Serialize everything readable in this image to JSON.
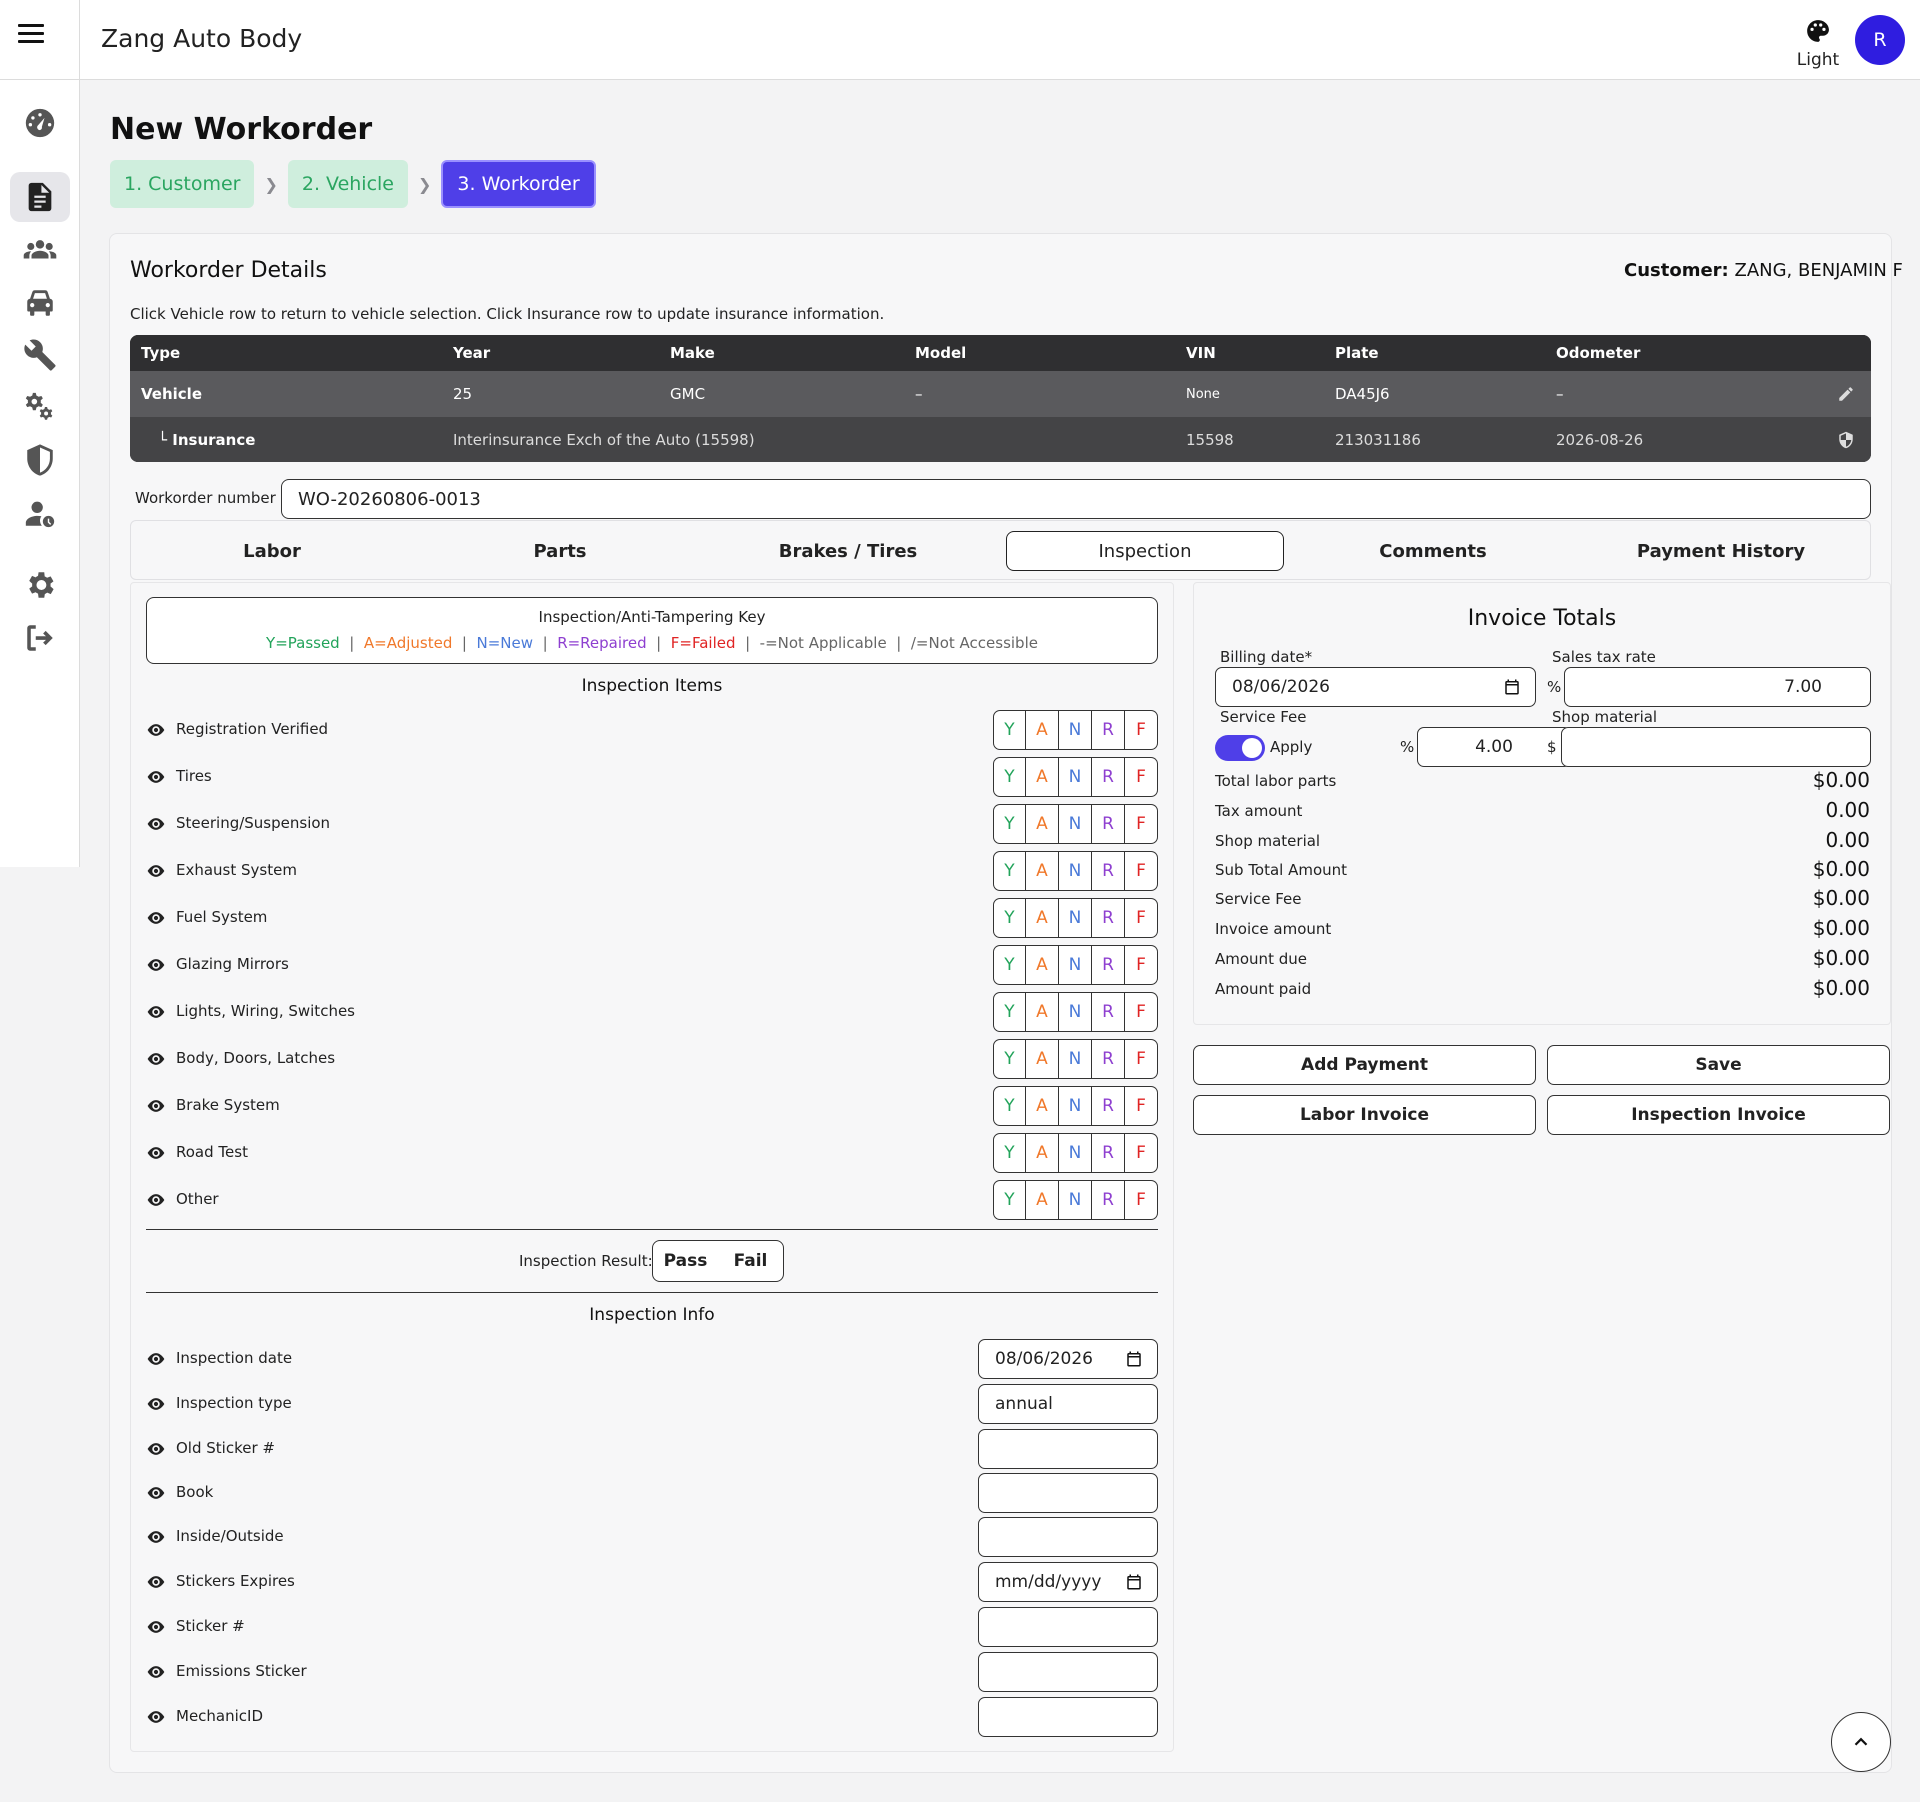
{
  "header": {
    "app_title": "Zang Auto Body",
    "theme_label": "Light",
    "avatar_initial": "R"
  },
  "sidebar": {
    "items": [
      "dashboard-icon",
      "workorders-icon",
      "customers-icon",
      "vehicles-icon",
      "services-icon",
      "settings-cogs-icon",
      "insurance-icon",
      "users-icon",
      "gear-icon",
      "logout-icon"
    ],
    "active_index": 1
  },
  "page": {
    "title": "New Workorder"
  },
  "stepper": {
    "steps": [
      "1. Customer",
      "2. Vehicle",
      "3. Workorder"
    ],
    "current": 2
  },
  "details": {
    "title": "Workorder Details",
    "customer_label": "Customer:",
    "customer_name": "ZANG, BENJAMIN F",
    "hint": "Click Vehicle row to return to vehicle selection. Click Insurance row to update insurance information."
  },
  "vehicle_table": {
    "headers": [
      "Type",
      "Year",
      "Make",
      "Model",
      "VIN",
      "Plate",
      "Odometer"
    ],
    "vehicle": [
      "Vehicle",
      "25",
      "GMC",
      "–",
      "None",
      "DA45J6",
      "–"
    ],
    "insurance": [
      "└ Insurance",
      "Interinsurance Exch of the Auto (15598)",
      "",
      "",
      "15598",
      "213031186",
      "2026-08-26"
    ]
  },
  "workorder": {
    "label": "Workorder number",
    "value": "WO-20260806-0013"
  },
  "tabs": [
    "Labor",
    "Parts",
    "Brakes / Tires",
    "Inspection",
    "Comments",
    "Payment History"
  ],
  "selected_tab": "Inspection",
  "key": {
    "title": "Inspection/Anti-Tampering Key",
    "y": "Y=Passed",
    "a": "A=Adjusted",
    "n": "N=New",
    "r": "R=Repaired",
    "f": "F=Failed",
    "na": "-=Not Applicable",
    "nacc": "/=Not Accessible",
    "sep": "|"
  },
  "inspection_items_title": "Inspection Items",
  "inspection_items": [
    "Registration Verified",
    "Tires",
    "Steering/Suspension",
    "Exhaust System",
    "Fuel System",
    "Glazing Mirrors",
    "Lights, Wiring, Switches",
    "Body, Doors, Latches",
    "Brake System",
    "Road Test",
    "Other"
  ],
  "status_buttons": [
    "Y",
    "A",
    "N",
    "R",
    "F"
  ],
  "result": {
    "label": "Inspection Result:",
    "pass": "Pass",
    "fail": "Fail"
  },
  "inspection_info_title": "Inspection Info",
  "inspection_info": [
    {
      "label": "Inspection date",
      "value": "08/06/2026",
      "type": "date"
    },
    {
      "label": "Inspection type",
      "value": "annual",
      "type": "text"
    },
    {
      "label": "Old Sticker #",
      "value": "",
      "type": "text"
    },
    {
      "label": "Book",
      "value": "",
      "type": "text"
    },
    {
      "label": "Inside/Outside",
      "value": "",
      "type": "text"
    },
    {
      "label": "Stickers Expires",
      "value": "mm/dd/yyyy",
      "type": "date"
    },
    {
      "label": "Sticker #",
      "value": "",
      "type": "text"
    },
    {
      "label": "Emissions Sticker",
      "value": "",
      "type": "text"
    },
    {
      "label": "MechanicID",
      "value": "",
      "type": "text"
    }
  ],
  "invoice": {
    "title": "Invoice Totals",
    "billing_date_label": "Billing date*",
    "billing_date": "08/06/2026",
    "sales_tax_label": "Sales tax rate",
    "sales_tax_prefix": "%",
    "sales_tax": "7.00",
    "service_fee_label": "Service Fee",
    "apply_label": "Apply",
    "service_fee_prefix": "%",
    "service_fee": "4.00",
    "shop_material_label": "Shop material",
    "shop_material_prefix": "$",
    "shop_material": "",
    "totals": [
      {
        "label": "Total labor parts",
        "value": "$0.00"
      },
      {
        "label": "Tax amount",
        "value": "0.00"
      },
      {
        "label": "Shop material",
        "value": "0.00"
      },
      {
        "label": "Sub Total Amount",
        "value": "$0.00"
      },
      {
        "label": "Service Fee",
        "value": "$0.00"
      },
      {
        "label": "Invoice amount",
        "value": "$0.00"
      },
      {
        "label": "Amount due",
        "value": "$0.00"
      },
      {
        "label": "Amount paid",
        "value": "$0.00"
      }
    ]
  },
  "actions": {
    "add_payment": "Add Payment",
    "save": "Save",
    "labor_invoice": "Labor Invoice",
    "inspection_invoice": "Inspection Invoice"
  },
  "colors": {
    "accent": "#4f3fe8",
    "avatar": "#2f1de0",
    "step_done_bg": "#cfeedd",
    "step_done_text": "#2aa560",
    "passed": "#22a35a",
    "adjusted": "#f0782a",
    "new": "#4a7ad8",
    "repaired": "#8e3fd0",
    "failed": "#e02424"
  }
}
